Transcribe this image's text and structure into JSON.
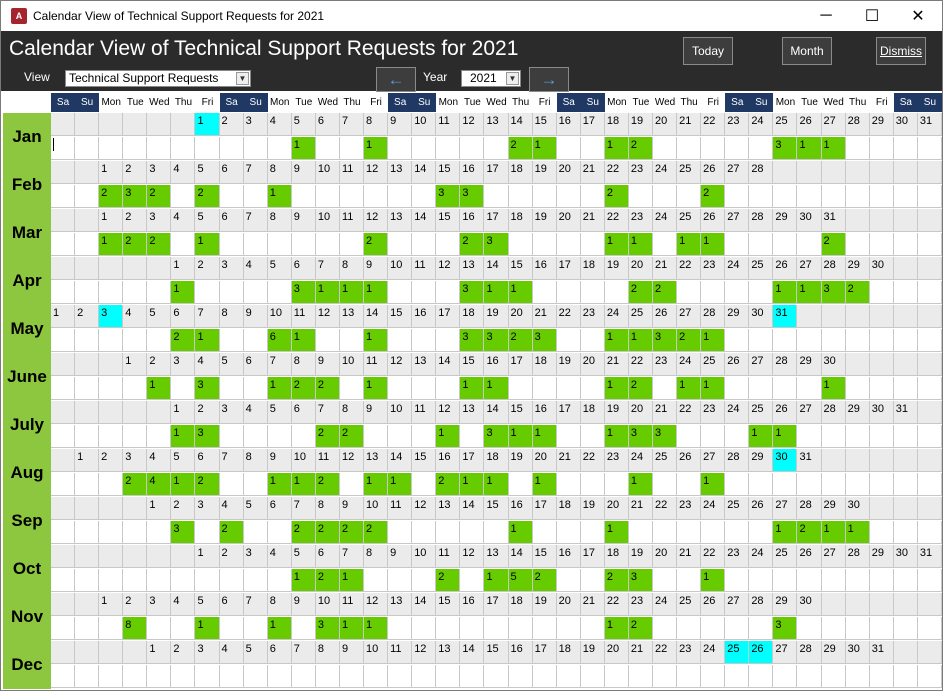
{
  "window": {
    "title": "Calendar View of Technical Support Requests for 2021",
    "icon": "access-icon",
    "icon_text": "A",
    "controls": {
      "minimize": "─",
      "maximize": "☐",
      "close": "✕"
    }
  },
  "header": {
    "title": "Calendar View of Technical Support Requests for 2021",
    "today_label": "Today",
    "month_label": "Month",
    "dismiss_label": "Dismiss",
    "view_label": "View",
    "view_value": "Technical Support Requests",
    "year_label": "Year",
    "year_value": "2021",
    "prev_icon": "arrow-left-icon",
    "next_icon": "arrow-right-icon"
  },
  "colors": {
    "header_bg": "#2b2b2b",
    "month_label": "#8dc63f",
    "count_cell": "#66cc00",
    "highlight_date": "#00ffff",
    "weekend_header": "#1f3864",
    "date_row": "#ebebeb"
  },
  "weekday_headers": [
    "Sa",
    "Su",
    "Mon",
    "Tue",
    "Wed",
    "Thu",
    "Fri",
    "Sa",
    "Su",
    "Mon",
    "Tue",
    "Wed",
    "Thu",
    "Fri",
    "Sa",
    "Su",
    "Mon",
    "Tue",
    "Wed",
    "Thu",
    "Fri",
    "Sa",
    "Su",
    "Mon",
    "Tue",
    "Wed",
    "Thu",
    "Fri",
    "Sa",
    "Su",
    "Mon",
    "Tue",
    "Wed",
    "Thu",
    "Fri",
    "Sa",
    "Su"
  ],
  "months": [
    {
      "name": "Jan",
      "start": 6,
      "days": 31,
      "highlight": [
        1
      ],
      "counts": {
        "5": 1,
        "8": 1,
        "14": 2,
        "15": 1,
        "18": 1,
        "19": 2,
        "25": 3,
        "26": 1,
        "27": 1
      }
    },
    {
      "name": "Feb",
      "start": 2,
      "days": 28,
      "highlight": [],
      "counts": {
        "1": 2,
        "2": 3,
        "3": 2,
        "5": 2,
        "8": 1,
        "15": 3,
        "16": 3,
        "22": 2,
        "26": 2
      }
    },
    {
      "name": "Mar",
      "start": 2,
      "days": 31,
      "highlight": [],
      "counts": {
        "1": 1,
        "2": 2,
        "3": 2,
        "5": 1,
        "12": 2,
        "16": 2,
        "17": 3,
        "22": 1,
        "23": 1,
        "25": 1,
        "26": 1,
        "31": 2
      }
    },
    {
      "name": "Apr",
      "start": 5,
      "days": 30,
      "highlight": [],
      "counts": {
        "1": 1,
        "6": 3,
        "7": 1,
        "8": 1,
        "9": 1,
        "13": 3,
        "14": 1,
        "15": 1,
        "20": 2,
        "21": 2,
        "26": 1,
        "27": 1,
        "28": 3,
        "29": 2
      }
    },
    {
      "name": "May",
      "start": 0,
      "days": 31,
      "highlight": [
        3,
        31
      ],
      "counts": {
        "6": 2,
        "7": 1,
        "10": 6,
        "11": 1,
        "14": 1,
        "18": 3,
        "19": 3,
        "20": 2,
        "21": 3,
        "24": 1,
        "25": 1,
        "26": 3,
        "27": 2,
        "28": 1
      }
    },
    {
      "name": "June",
      "start": 3,
      "days": 30,
      "highlight": [],
      "counts": {
        "2": 1,
        "4": 3,
        "7": 1,
        "8": 2,
        "9": 2,
        "11": 1,
        "15": 1,
        "16": 1,
        "21": 1,
        "22": 2,
        "24": 1,
        "25": 1,
        "30": 1
      }
    },
    {
      "name": "July",
      "start": 5,
      "days": 31,
      "highlight": [],
      "counts": {
        "1": 1,
        "2": 3,
        "7": 2,
        "8": 2,
        "12": 1,
        "14": 3,
        "15": 1,
        "16": 1,
        "19": 1,
        "20": 3,
        "21": 3,
        "25": 1,
        "26": 1
      }
    },
    {
      "name": "Aug",
      "start": 1,
      "days": 31,
      "highlight": [
        30
      ],
      "counts": {
        "3": 2,
        "4": 4,
        "5": 1,
        "6": 2,
        "9": 1,
        "10": 1,
        "11": 2,
        "13": 1,
        "14": 1,
        "16": 2,
        "17": 1,
        "18": 1,
        "20": 1,
        "24": 1,
        "27": 1
      }
    },
    {
      "name": "Sep",
      "start": 4,
      "days": 30,
      "highlight": [],
      "counts": {
        "2": 3,
        "4": 2,
        "7": 2,
        "8": 2,
        "9": 2,
        "10": 2,
        "16": 1,
        "20": 1,
        "27": 1,
        "28": 2,
        "29": 1,
        "30": 1
      }
    },
    {
      "name": "Oct",
      "start": 6,
      "days": 31,
      "highlight": [],
      "counts": {
        "5": 1,
        "6": 2,
        "7": 1,
        "11": 2,
        "13": 1,
        "14": 5,
        "15": 2,
        "18": 2,
        "19": 3,
        "22": 1
      }
    },
    {
      "name": "Nov",
      "start": 2,
      "days": 30,
      "highlight": [],
      "counts": {
        "2": 8,
        "5": 1,
        "8": 1,
        "10": 3,
        "11": 1,
        "12": 1,
        "22": 1,
        "23": 2,
        "29": 3
      }
    },
    {
      "name": "Dec",
      "start": 4,
      "days": 31,
      "highlight": [
        25,
        26
      ],
      "counts": {}
    }
  ]
}
